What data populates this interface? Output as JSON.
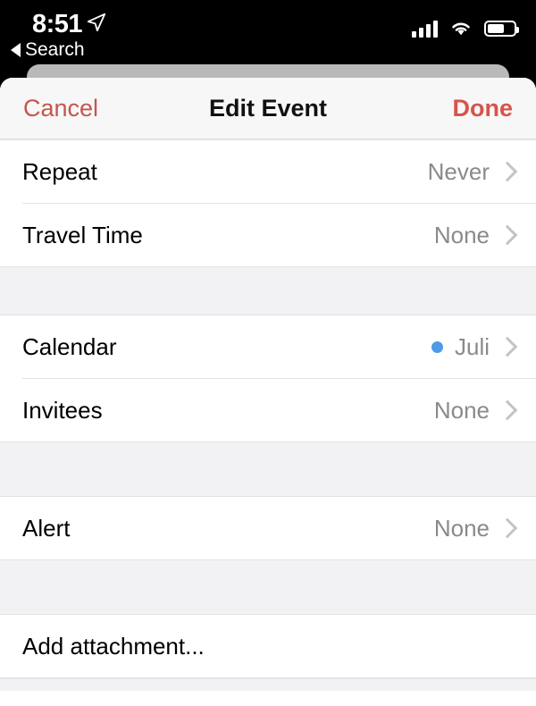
{
  "status_bar": {
    "time": "8:51",
    "location_icon": "location-arrow-icon",
    "back_label": "Search",
    "cellular_icon": "cellular-signal-icon",
    "cellular_bars_filled": 3,
    "cellular_bars_total": 4,
    "wifi_icon": "wifi-icon",
    "battery_icon": "battery-icon",
    "battery_level_percent": 62
  },
  "navbar": {
    "cancel_label": "Cancel",
    "title": "Edit Event",
    "done_label": "Done",
    "cancel_color": "#c4564e",
    "done_color": "#d6544b"
  },
  "sections": [
    {
      "rows": [
        {
          "label": "Repeat",
          "value": "Never",
          "chevron": "chevron-right-icon"
        },
        {
          "label": "Travel Time",
          "value": "None",
          "chevron": "chevron-right-icon"
        }
      ]
    },
    {
      "rows": [
        {
          "label": "Calendar",
          "value": "Juli",
          "dot_color": "#4e9ae4",
          "chevron": "chevron-right-icon"
        },
        {
          "label": "Invitees",
          "value": "None",
          "chevron": "chevron-right-icon"
        }
      ]
    },
    {
      "rows": [
        {
          "label": "Alert",
          "value": "None",
          "chevron": "chevron-right-icon"
        }
      ]
    },
    {
      "rows": [
        {
          "label": "Add attachment...",
          "value": ""
        }
      ]
    }
  ],
  "colors": {
    "sheet_background": "#ffffff",
    "navbar_background": "#f7f7f7",
    "group_gap": "#f2f1f4",
    "separator": "#e3e3e5",
    "value_text": "#8a8a8e",
    "chevron": "#c3c3c8"
  }
}
